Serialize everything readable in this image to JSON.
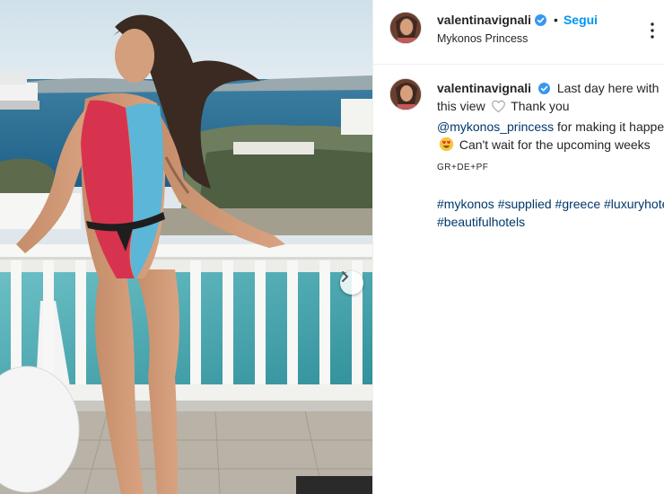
{
  "post": {
    "username": "valentinavignali",
    "location": "Mykonos Princess",
    "follow_label": "Segui",
    "separator": "•",
    "caption": {
      "part1": "Last day here with this view",
      "part2": "Thank you",
      "mention": "@mykonos_princess",
      "part3": "for making it happen",
      "part4": "Can't wait for the upcoming weeks",
      "codes": "GR+DE+PF",
      "hashtags": [
        "#mykonos",
        "#supplied",
        "#greece",
        "#luxuryhotel",
        "#beautifulhotels"
      ]
    }
  },
  "icons": {
    "verified": "verified-badge-icon",
    "heart": "white-heart-icon",
    "emoji": "heart-eyes-emoji-icon",
    "more": "more-options-icon",
    "next": "chevron-right-icon"
  },
  "colors": {
    "link_blue": "#0095f6",
    "hashtag": "#00376b",
    "verified": "#3897f0"
  }
}
